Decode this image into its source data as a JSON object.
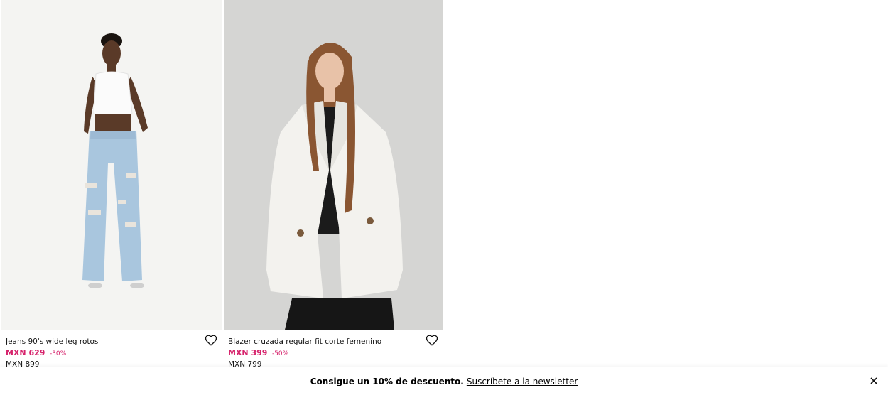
{
  "products": [
    {
      "name": "Jeans 90's wide leg rotos",
      "price": "MXN 629",
      "discount": "-30%",
      "old_price": "MXN 899"
    },
    {
      "name": "Blazer cruzada regular fit corte femenino",
      "price": "MXN 399",
      "discount": "-50%",
      "old_price": "MXN 799"
    }
  ],
  "newsletter": {
    "text": "Consigue un 10% de descuento.",
    "link": "Suscríbete a la newsletter"
  },
  "icons": {
    "wishlist": "heart-outline-icon",
    "close": "close-icon"
  },
  "colors": {
    "sale_price": "#d6226b"
  }
}
